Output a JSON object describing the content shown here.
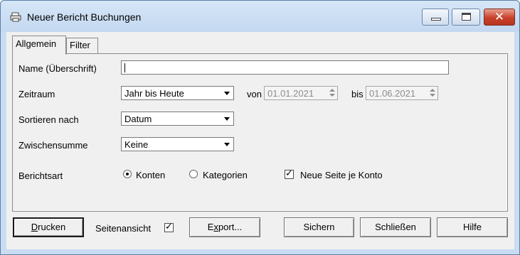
{
  "window": {
    "title": "Neuer Bericht Buchungen",
    "icon": "printer-icon",
    "controls": {
      "close_glyph": "✕"
    }
  },
  "tabs": [
    {
      "label": "Allgemein",
      "active": true
    },
    {
      "label": "Filter",
      "active": false
    }
  ],
  "form": {
    "name_label": "Name (Überschrift)",
    "name_value": "",
    "zeitraum_label": "Zeitraum",
    "zeitraum_value": "Jahr bis Heute",
    "von_label": "von",
    "von_value": "01.01.2021",
    "bis_label": "bis",
    "bis_value": "01.06.2021",
    "sortieren_label": "Sortieren nach",
    "sortieren_value": "Datum",
    "zwischensumme_label": "Zwischensumme",
    "zwischensumme_value": "Keine",
    "berichtsart_label": "Berichtsart",
    "radio_konten": "Konten",
    "radio_konten_selected": true,
    "radio_kategorien": "Kategorien",
    "radio_kategorien_selected": false,
    "neue_seite_label": "Neue Seite je Konto",
    "neue_seite_checked": true
  },
  "footer": {
    "drucken_first": "D",
    "drucken_rest": "rucken",
    "seitenansicht_label": "Seitenansicht",
    "seitenansicht_checked": true,
    "export_pre": "E",
    "export_ul": "x",
    "export_post": "port...",
    "sichern": "Sichern",
    "schliessen": "Schließen",
    "hilfe": "Hilfe"
  },
  "checkmark": "✓"
}
